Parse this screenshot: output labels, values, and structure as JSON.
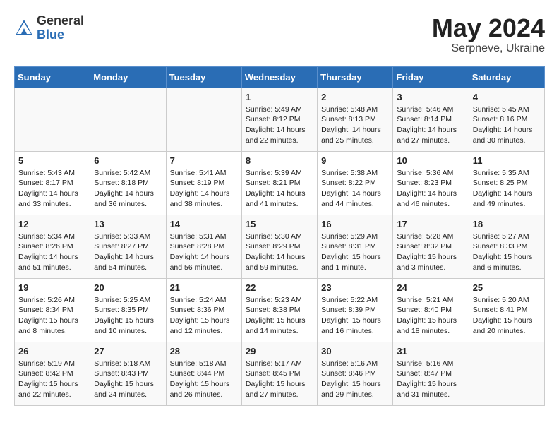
{
  "header": {
    "logo_general": "General",
    "logo_blue": "Blue",
    "month_title": "May 2024",
    "subtitle": "Serpneve, Ukraine"
  },
  "days_of_week": [
    "Sunday",
    "Monday",
    "Tuesday",
    "Wednesday",
    "Thursday",
    "Friday",
    "Saturday"
  ],
  "weeks": [
    [
      {
        "day": "",
        "info": ""
      },
      {
        "day": "",
        "info": ""
      },
      {
        "day": "",
        "info": ""
      },
      {
        "day": "1",
        "info": "Sunrise: 5:49 AM\nSunset: 8:12 PM\nDaylight: 14 hours\nand 22 minutes."
      },
      {
        "day": "2",
        "info": "Sunrise: 5:48 AM\nSunset: 8:13 PM\nDaylight: 14 hours\nand 25 minutes."
      },
      {
        "day": "3",
        "info": "Sunrise: 5:46 AM\nSunset: 8:14 PM\nDaylight: 14 hours\nand 27 minutes."
      },
      {
        "day": "4",
        "info": "Sunrise: 5:45 AM\nSunset: 8:16 PM\nDaylight: 14 hours\nand 30 minutes."
      }
    ],
    [
      {
        "day": "5",
        "info": "Sunrise: 5:43 AM\nSunset: 8:17 PM\nDaylight: 14 hours\nand 33 minutes."
      },
      {
        "day": "6",
        "info": "Sunrise: 5:42 AM\nSunset: 8:18 PM\nDaylight: 14 hours\nand 36 minutes."
      },
      {
        "day": "7",
        "info": "Sunrise: 5:41 AM\nSunset: 8:19 PM\nDaylight: 14 hours\nand 38 minutes."
      },
      {
        "day": "8",
        "info": "Sunrise: 5:39 AM\nSunset: 8:21 PM\nDaylight: 14 hours\nand 41 minutes."
      },
      {
        "day": "9",
        "info": "Sunrise: 5:38 AM\nSunset: 8:22 PM\nDaylight: 14 hours\nand 44 minutes."
      },
      {
        "day": "10",
        "info": "Sunrise: 5:36 AM\nSunset: 8:23 PM\nDaylight: 14 hours\nand 46 minutes."
      },
      {
        "day": "11",
        "info": "Sunrise: 5:35 AM\nSunset: 8:25 PM\nDaylight: 14 hours\nand 49 minutes."
      }
    ],
    [
      {
        "day": "12",
        "info": "Sunrise: 5:34 AM\nSunset: 8:26 PM\nDaylight: 14 hours\nand 51 minutes."
      },
      {
        "day": "13",
        "info": "Sunrise: 5:33 AM\nSunset: 8:27 PM\nDaylight: 14 hours\nand 54 minutes."
      },
      {
        "day": "14",
        "info": "Sunrise: 5:31 AM\nSunset: 8:28 PM\nDaylight: 14 hours\nand 56 minutes."
      },
      {
        "day": "15",
        "info": "Sunrise: 5:30 AM\nSunset: 8:29 PM\nDaylight: 14 hours\nand 59 minutes."
      },
      {
        "day": "16",
        "info": "Sunrise: 5:29 AM\nSunset: 8:31 PM\nDaylight: 15 hours\nand 1 minute."
      },
      {
        "day": "17",
        "info": "Sunrise: 5:28 AM\nSunset: 8:32 PM\nDaylight: 15 hours\nand 3 minutes."
      },
      {
        "day": "18",
        "info": "Sunrise: 5:27 AM\nSunset: 8:33 PM\nDaylight: 15 hours\nand 6 minutes."
      }
    ],
    [
      {
        "day": "19",
        "info": "Sunrise: 5:26 AM\nSunset: 8:34 PM\nDaylight: 15 hours\nand 8 minutes."
      },
      {
        "day": "20",
        "info": "Sunrise: 5:25 AM\nSunset: 8:35 PM\nDaylight: 15 hours\nand 10 minutes."
      },
      {
        "day": "21",
        "info": "Sunrise: 5:24 AM\nSunset: 8:36 PM\nDaylight: 15 hours\nand 12 minutes."
      },
      {
        "day": "22",
        "info": "Sunrise: 5:23 AM\nSunset: 8:38 PM\nDaylight: 15 hours\nand 14 minutes."
      },
      {
        "day": "23",
        "info": "Sunrise: 5:22 AM\nSunset: 8:39 PM\nDaylight: 15 hours\nand 16 minutes."
      },
      {
        "day": "24",
        "info": "Sunrise: 5:21 AM\nSunset: 8:40 PM\nDaylight: 15 hours\nand 18 minutes."
      },
      {
        "day": "25",
        "info": "Sunrise: 5:20 AM\nSunset: 8:41 PM\nDaylight: 15 hours\nand 20 minutes."
      }
    ],
    [
      {
        "day": "26",
        "info": "Sunrise: 5:19 AM\nSunset: 8:42 PM\nDaylight: 15 hours\nand 22 minutes."
      },
      {
        "day": "27",
        "info": "Sunrise: 5:18 AM\nSunset: 8:43 PM\nDaylight: 15 hours\nand 24 minutes."
      },
      {
        "day": "28",
        "info": "Sunrise: 5:18 AM\nSunset: 8:44 PM\nDaylight: 15 hours\nand 26 minutes."
      },
      {
        "day": "29",
        "info": "Sunrise: 5:17 AM\nSunset: 8:45 PM\nDaylight: 15 hours\nand 27 minutes."
      },
      {
        "day": "30",
        "info": "Sunrise: 5:16 AM\nSunset: 8:46 PM\nDaylight: 15 hours\nand 29 minutes."
      },
      {
        "day": "31",
        "info": "Sunrise: 5:16 AM\nSunset: 8:47 PM\nDaylight: 15 hours\nand 31 minutes."
      },
      {
        "day": "",
        "info": ""
      }
    ]
  ]
}
